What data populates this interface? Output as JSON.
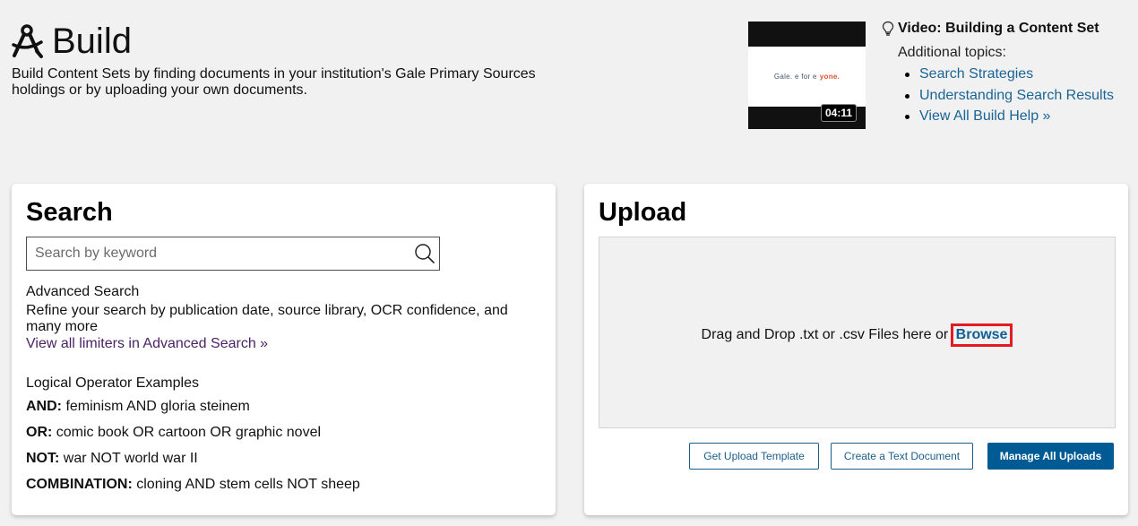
{
  "header": {
    "title": "Build",
    "icon": "compass-icon",
    "description": "Build Content Sets by finding documents in your institution's Gale Primary Sources holdings or by uploading your own documents."
  },
  "video": {
    "thumbnail_text": "Gale.  e for e  ",
    "thumbnail_accent": "yone.",
    "duration": "04:11",
    "title": "Video: Building a Content Set",
    "icon": "lightbulb-icon",
    "additional_label": "Additional topics:",
    "topics": [
      {
        "label": "Search Strategies"
      },
      {
        "label": "Understanding Search Results"
      },
      {
        "label": "View All Build Help »"
      }
    ]
  },
  "search": {
    "heading": "Search",
    "placeholder": "Search by keyword",
    "value": "",
    "advanced_title": "Advanced Search",
    "advanced_desc": "Refine your search by publication date, source library, OCR confidence, and many more",
    "advanced_link": "View all limiters in Advanced Search »",
    "operators_title": "Logical Operator Examples",
    "operators": [
      {
        "key": "AND:",
        "example": " feminism AND gloria steinem"
      },
      {
        "key": "OR:",
        "example": " comic book OR cartoon OR graphic novel"
      },
      {
        "key": "NOT:",
        "example": " war NOT world war II"
      },
      {
        "key": "COMBINATION:",
        "example": " cloning AND stem cells NOT sheep"
      }
    ]
  },
  "upload": {
    "heading": "Upload",
    "drop_text": "Drag and Drop .txt or .csv Files here or ",
    "browse_label": "Browse",
    "buttons": {
      "template": "Get Upload Template",
      "create": "Create a Text Document",
      "manage": "Manage All Uploads"
    }
  },
  "colors": {
    "link": "#1a6496",
    "visited_link": "#4b2266",
    "primary": "#005a94",
    "highlight": "#e31b23"
  }
}
